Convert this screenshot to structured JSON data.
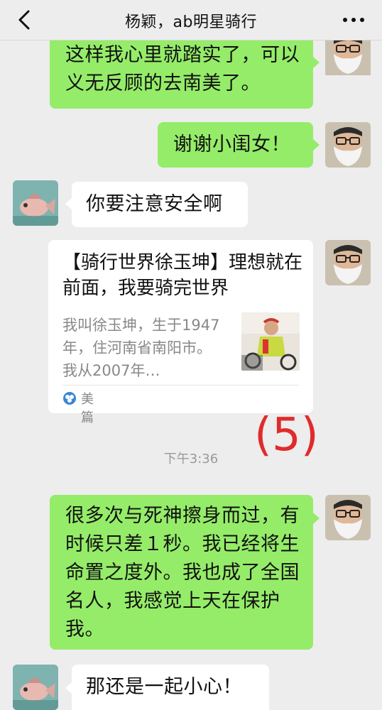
{
  "header": {
    "title": "杨颖，ab明星骑行"
  },
  "messages": [
    {
      "text": "这样我心里就踏实了，可以义无反顾的去南美了。"
    },
    {
      "text": "谢谢小闺女！"
    },
    {
      "text": "你要注意安全啊"
    },
    {
      "text": "很多次与死神擦身而过，有时候只差１秒。我已经将生命置之度外。我也成了全国名人，我感觉上天在保护我。"
    },
    {
      "text": "那还是一起小心！"
    }
  ],
  "link_card": {
    "title": "【骑行世界徐玉坤】理想就在前面，我要骑完世界",
    "description": "我叫徐玉坤，生于1947年，住河南省南阳市。我从2007年…",
    "source": "美篇",
    "source_icon": "meipian-logo-icon"
  },
  "stamp_text": "(5)",
  "timestamp": "下午3:36",
  "colors": {
    "sent_bubble": "#95ec69",
    "received_bubble": "#ffffff",
    "background": "#ededed",
    "stamp": "#e02b2b"
  }
}
